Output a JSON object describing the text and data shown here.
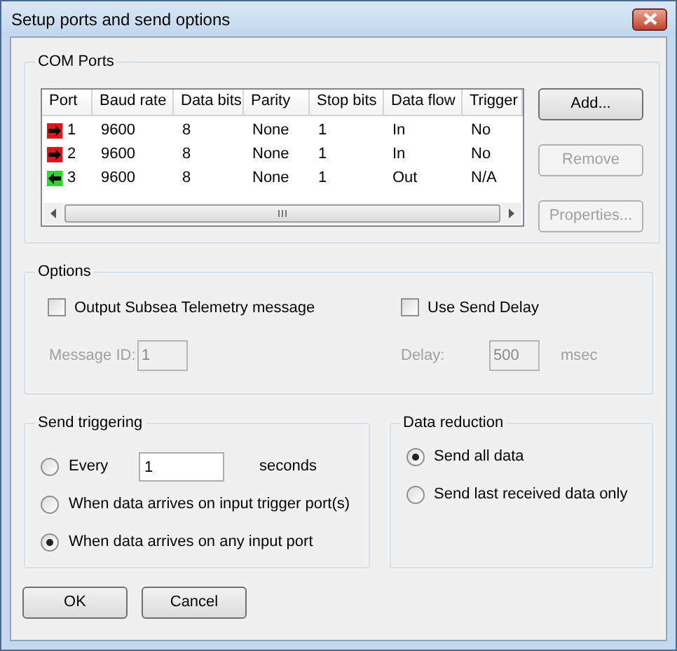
{
  "window": {
    "title": "Setup ports and send options"
  },
  "com_ports": {
    "title": "COM Ports",
    "columns": [
      "Port",
      "Baud rate",
      "Data bits",
      "Parity",
      "Stop bits",
      "Data flow",
      "Trigger"
    ],
    "rows": [
      {
        "kind": "in",
        "cells": [
          "1",
          "9600",
          "8",
          "None",
          "1",
          "In",
          "No"
        ]
      },
      {
        "kind": "in",
        "cells": [
          "2",
          "9600",
          "8",
          "None",
          "1",
          "In",
          "No"
        ]
      },
      {
        "kind": "out",
        "cells": [
          "3",
          "9600",
          "8",
          "None",
          "1",
          "Out",
          "N/A"
        ]
      }
    ],
    "buttons": [
      {
        "label": "Add...",
        "disabled": false
      },
      {
        "label": "Remove",
        "disabled": true
      },
      {
        "label": "Properties...",
        "disabled": true
      }
    ]
  },
  "options": {
    "title": "Options",
    "checkboxes": [
      {
        "label": "Output Subsea Telemetry message",
        "checked": false
      },
      {
        "label": "Use Send Delay",
        "checked": false
      }
    ],
    "fields": [
      {
        "label": "Message ID:",
        "value": "1",
        "disabled": true
      },
      {
        "label": "Delay:",
        "value": "500",
        "unit": "msec",
        "disabled": true
      }
    ]
  },
  "send_triggering": {
    "title": "Send triggering",
    "options": [
      {
        "kind": "interval",
        "label": "Every",
        "value": "1",
        "unit": "seconds",
        "selected": false
      },
      {
        "kind": "plain",
        "label": "When data arrives on input trigger port(s)",
        "selected": false
      },
      {
        "kind": "plain",
        "label": "When data arrives on any input port",
        "selected": true
      }
    ]
  },
  "data_reduction": {
    "title": "Data reduction",
    "options": [
      {
        "label": "Send all data",
        "selected": true
      },
      {
        "label": "Send last received data only",
        "selected": false
      }
    ]
  },
  "buttons": [
    {
      "label": "OK"
    },
    {
      "label": "Cancel"
    }
  ]
}
